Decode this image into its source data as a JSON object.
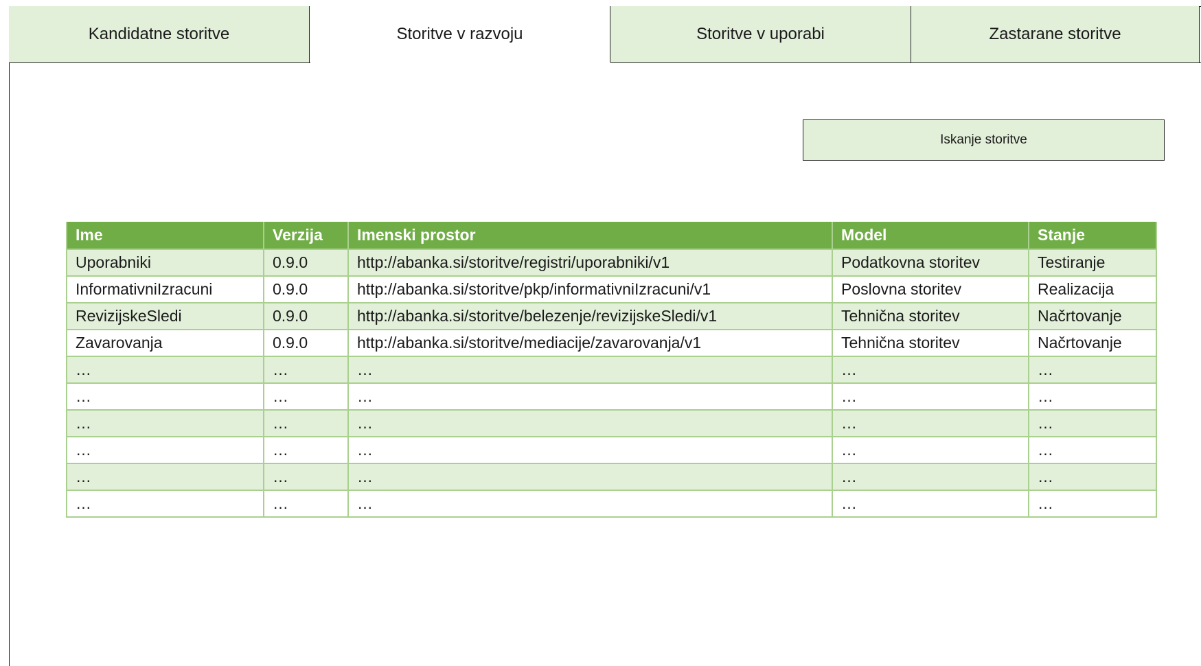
{
  "tabs": [
    {
      "label": "Kandidatne storitve",
      "active": false
    },
    {
      "label": "Storitve v razvoju",
      "active": true
    },
    {
      "label": "Storitve v uporabi",
      "active": false
    },
    {
      "label": "Zastarane storitve",
      "active": false
    }
  ],
  "search_button": {
    "label": "Iskanje storitve"
  },
  "table": {
    "headers": [
      "Ime",
      "Verzija",
      "Imenski prostor",
      "Model",
      "Stanje"
    ],
    "rows": [
      [
        "Uporabniki",
        "0.9.0",
        "http://abanka.si/storitve/registri/uporabniki/v1",
        "Podatkovna storitev",
        "Testiranje"
      ],
      [
        "InformativniIzracuni",
        "0.9.0",
        "http://abanka.si/storitve/pkp/informativniIzracuni/v1",
        "Poslovna storitev",
        "Realizacija"
      ],
      [
        "RevizijskeSledi",
        "0.9.0",
        "http://abanka.si/storitve/belezenje/revizijskeSledi/v1",
        "Tehnična storitev",
        "Načrtovanje"
      ],
      [
        "Zavarovanja",
        "0.9.0",
        "http://abanka.si/storitve/mediacije/zavarovanja/v1",
        "Tehnična storitev",
        "Načrtovanje"
      ],
      [
        "…",
        "…",
        "…",
        "…",
        "…"
      ],
      [
        "…",
        "…",
        "…",
        "…",
        "…"
      ],
      [
        "…",
        "…",
        "…",
        "…",
        "…"
      ],
      [
        "…",
        "…",
        "…",
        "…",
        "…"
      ],
      [
        "…",
        "…",
        "…",
        "…",
        "…"
      ],
      [
        "…",
        "…",
        "…",
        "…",
        "…"
      ]
    ]
  },
  "colors": {
    "header_bg": "#70ad47",
    "band_bg": "#e2efd9",
    "border": "#a9d08e"
  }
}
